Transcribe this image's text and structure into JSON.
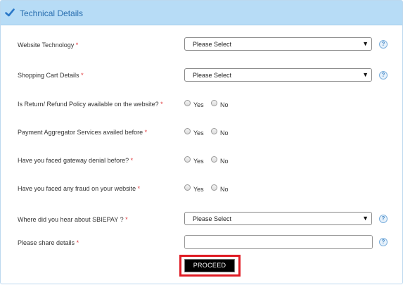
{
  "section": {
    "title": "Technical Details",
    "required_mark": "*",
    "help_glyph": "?"
  },
  "fields": {
    "website_technology": {
      "label": "Website Technology",
      "value": "Please Select"
    },
    "shopping_cart": {
      "label": "Shopping Cart Details",
      "value": "Please Select"
    },
    "refund_policy": {
      "label": "Is Return/ Refund Policy available on the website?",
      "yes": "Yes",
      "no": "No"
    },
    "payment_aggregator": {
      "label": "Payment Aggregator Services availed before",
      "yes": "Yes",
      "no": "No"
    },
    "gateway_denial": {
      "label": "Have you faced gateway denial before?",
      "yes": "Yes",
      "no": "No"
    },
    "fraud": {
      "label": "Have you faced any fraud on your website",
      "yes": "Yes",
      "no": "No"
    },
    "hear_about": {
      "label": "Where did you hear about SBIEPAY ?",
      "value": "Please Select"
    },
    "share_details": {
      "label": "Please share details",
      "value": ""
    }
  },
  "actions": {
    "proceed_label": "PROCEED"
  },
  "colors": {
    "header_bg": "#b7dcf6",
    "title_color": "#2a6fb0",
    "required_color": "#e0363a",
    "highlight_border": "#e01b24",
    "button_bg": "#000000"
  }
}
